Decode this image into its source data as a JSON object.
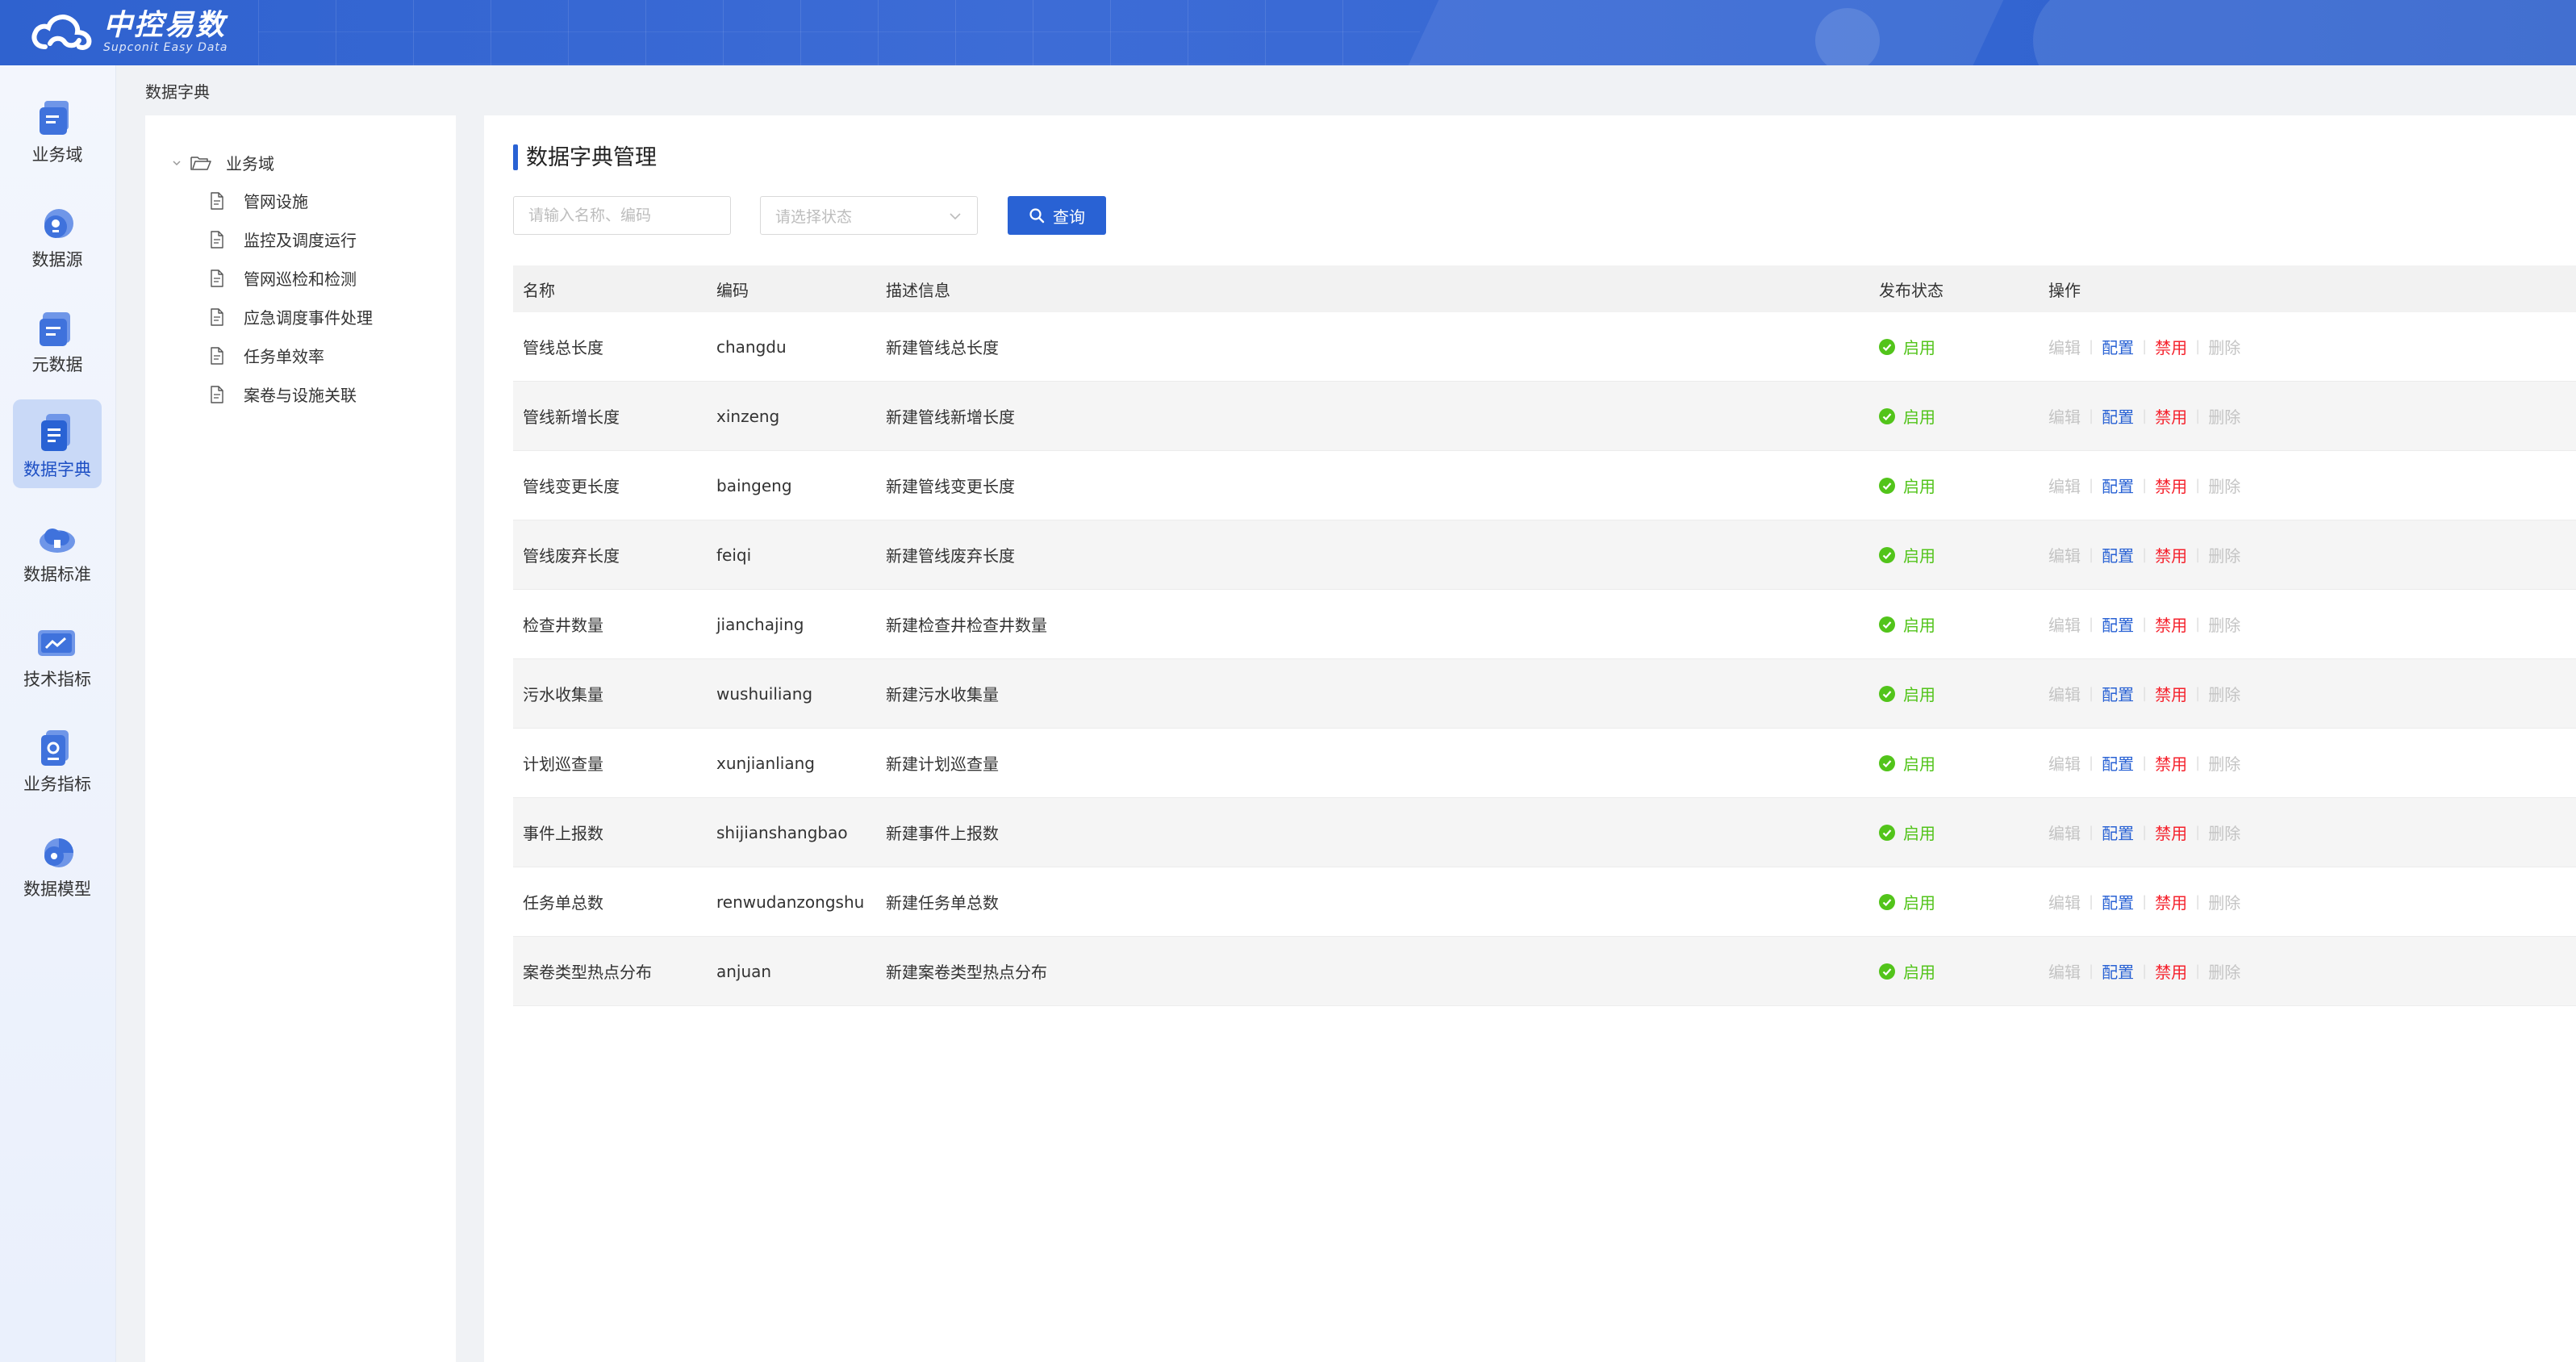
{
  "app": {
    "logo_title": "中控易数",
    "logo_subtitle": "Supconit Easy Data"
  },
  "sidenav": {
    "items": [
      {
        "label": "业务域",
        "icon": "business-domain-icon",
        "active": false
      },
      {
        "label": "数据源",
        "icon": "data-source-icon",
        "active": false
      },
      {
        "label": "元数据",
        "icon": "metadata-icon",
        "active": false
      },
      {
        "label": "数据字典",
        "icon": "data-dictionary-icon",
        "active": true
      },
      {
        "label": "数据标准",
        "icon": "data-standard-icon",
        "active": false
      },
      {
        "label": "技术指标",
        "icon": "tech-indicator-icon",
        "active": false
      },
      {
        "label": "业务指标",
        "icon": "business-indicator-icon",
        "active": false
      },
      {
        "label": "数据模型",
        "icon": "data-model-icon",
        "active": false
      }
    ],
    "accent": "#2962d4"
  },
  "breadcrumb": "数据字典",
  "tree": {
    "root": "业务域",
    "children": [
      "管网设施",
      "监控及调度运行",
      "管网巡检和检测",
      "应急调度事件处理",
      "任务单效率",
      "案卷与设施关联"
    ]
  },
  "main": {
    "title": "数据字典管理",
    "search_placeholder": "请输入名称、编码",
    "status_placeholder": "请选择状态",
    "query_label": "查询"
  },
  "table": {
    "headers": {
      "name": "名称",
      "code": "编码",
      "desc": "描述信息",
      "status": "发布状态",
      "ops": "操作"
    },
    "ops": {
      "edit": "编辑",
      "config": "配置",
      "disable": "禁用",
      "delete": "删除"
    },
    "rows": [
      {
        "name": "管线总长度",
        "code": "changdu",
        "desc": "新建管线总长度",
        "status": "启用"
      },
      {
        "name": "管线新增长度",
        "code": "xinzeng",
        "desc": "新建管线新增长度",
        "status": "启用"
      },
      {
        "name": "管线变更长度",
        "code": "baingeng",
        "desc": "新建管线变更长度",
        "status": "启用"
      },
      {
        "name": "管线废弃长度",
        "code": "feiqi",
        "desc": "新建管线废弃长度",
        "status": "启用"
      },
      {
        "name": "检查井数量",
        "code": "jianchajing",
        "desc": "新建检查井检查井数量",
        "status": "启用"
      },
      {
        "name": "污水收集量",
        "code": "wushuiliang",
        "desc": "新建污水收集量",
        "status": "启用"
      },
      {
        "name": "计划巡查量",
        "code": "xunjianliang",
        "desc": "新建计划巡查量",
        "status": "启用"
      },
      {
        "name": "事件上报数",
        "code": "shijianshangbao",
        "desc": "新建事件上报数",
        "status": "启用"
      },
      {
        "name": "任务单总数",
        "code": "renwudanzongshu",
        "desc": "新建任务单总数",
        "status": "启用"
      },
      {
        "name": "案卷类型热点分布",
        "code": "anjuan",
        "desc": "新建案卷类型热点分布",
        "status": "启用"
      }
    ]
  },
  "colors": {
    "primary": "#2962d4",
    "status_enabled": "#52c41a",
    "danger": "#f5222d",
    "disabled": "#c4c4c4"
  }
}
